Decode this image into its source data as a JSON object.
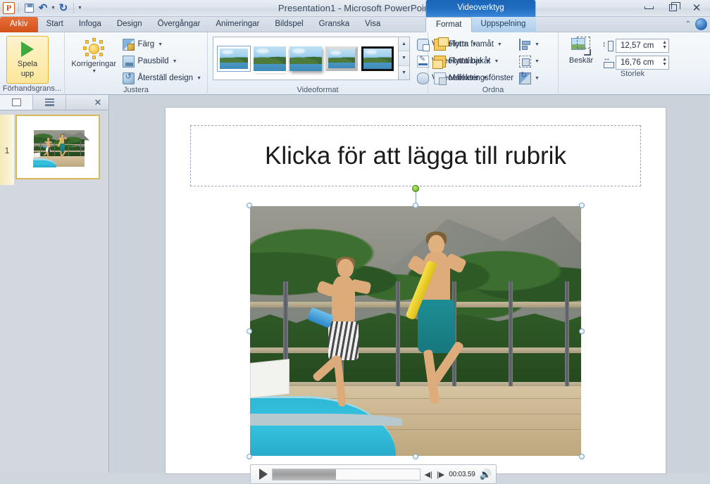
{
  "titlebar": {
    "app_logo": "powerpoint-logo",
    "document_title": "Presentation1  -  Microsoft PowerPoint",
    "qat": [
      {
        "name": "save",
        "icon": "save-icon"
      },
      {
        "name": "undo",
        "icon": "undo-icon"
      },
      {
        "name": "redo",
        "icon": "redo-icon"
      },
      {
        "name": "customize",
        "icon": "chevron-down-icon"
      }
    ],
    "contextual_banner": "Videoverktyg",
    "window_buttons": {
      "minimize": "–",
      "restore": "❐",
      "close": "✕"
    }
  },
  "tabs": {
    "file": "Arkiv",
    "items": [
      "Start",
      "Infoga",
      "Design",
      "Övergångar",
      "Animeringar",
      "Bildspel",
      "Granska",
      "Visa"
    ],
    "contextual": [
      "Format",
      "Uppspelning"
    ],
    "active": "Format"
  },
  "ribbon": {
    "groups": [
      {
        "label": "Förhandsgrans...",
        "big_button": {
          "line1": "Spela",
          "line2": "upp",
          "icon": "play-icon"
        }
      },
      {
        "label": "Justera",
        "vertical_button": {
          "label": "Korrigeringar",
          "icon": "brightness-icon"
        },
        "items": [
          {
            "label": "Färg",
            "icon": "color-icon",
            "has_dropdown": true
          },
          {
            "label": "Pausbild",
            "icon": "poster-frame-icon",
            "has_dropdown": true
          },
          {
            "label": "Återställ design",
            "icon": "reset-design-icon",
            "has_dropdown": true
          }
        ]
      },
      {
        "label": "Videoformat",
        "gallery_styles": [
          "style-1",
          "style-2",
          "style-3",
          "style-4",
          "style-5"
        ],
        "gallery_scroll": [
          "scroll-up",
          "scroll-down",
          "more-styles"
        ],
        "items": [
          {
            "label": "Videoform",
            "icon": "video-shape-icon",
            "has_dropdown": true
          },
          {
            "label": "Videokantlinje",
            "icon": "video-border-icon",
            "has_dropdown": true
          },
          {
            "label": "Videoeffekter",
            "icon": "video-effects-icon",
            "has_dropdown": true
          }
        ],
        "has_dialog_launcher": true
      },
      {
        "label": "Ordna",
        "items": [
          {
            "label": "Flytta framåt",
            "icon": "bring-forward-icon",
            "has_dropdown": true
          },
          {
            "label": "Flytta bakåt",
            "icon": "send-backward-icon",
            "has_dropdown": true
          },
          {
            "label": "Markeringsfönster",
            "icon": "selection-pane-icon",
            "has_dropdown": false
          }
        ],
        "icon_items": [
          {
            "name": "align-icon",
            "has_dropdown": true
          },
          {
            "name": "group-icon",
            "has_dropdown": true
          },
          {
            "name": "rotate-icon",
            "has_dropdown": true
          }
        ]
      },
      {
        "label": "Storlek",
        "crop": {
          "label": "Beskär",
          "icon": "crop-icon"
        },
        "height": {
          "icon": "height-icon",
          "value": "12,57 cm"
        },
        "width": {
          "icon": "width-icon",
          "value": "16,76 cm"
        },
        "has_dialog_launcher": true
      }
    ]
  },
  "slide_pane": {
    "tab_slides": "slides-tab",
    "tab_outline": "outline-tab",
    "close": "✕",
    "slides": [
      {
        "number": "1",
        "thumbnail": "video-thumbnail"
      }
    ]
  },
  "slide": {
    "title_placeholder": "Klicka för att lägga till rubrik",
    "video": {
      "selected": true,
      "handles": [
        "top-left",
        "top-center",
        "top-right",
        "middle-left",
        "middle-right",
        "bottom-left",
        "bottom-center",
        "bottom-right"
      ],
      "description": "Two boys running beside a swimming pool holding pool noodles"
    }
  },
  "player": {
    "play_icon": "play-icon",
    "progress_percent": 43,
    "step_back_icon": "step-back-icon",
    "step_forward_icon": "step-forward-icon",
    "time": "00:03.59",
    "volume_icon": "volume-icon"
  },
  "help": {
    "collapse_ribbon": "chevron-up-icon",
    "help_button": "help-icon"
  },
  "colors": {
    "accent_orange": "#d2511c",
    "contextual_blue": "#1f6dc2",
    "ribbon_bg": "#eef3f8",
    "play_green": "#3fa93f",
    "rotate_handle_green": "#5fb01d"
  }
}
